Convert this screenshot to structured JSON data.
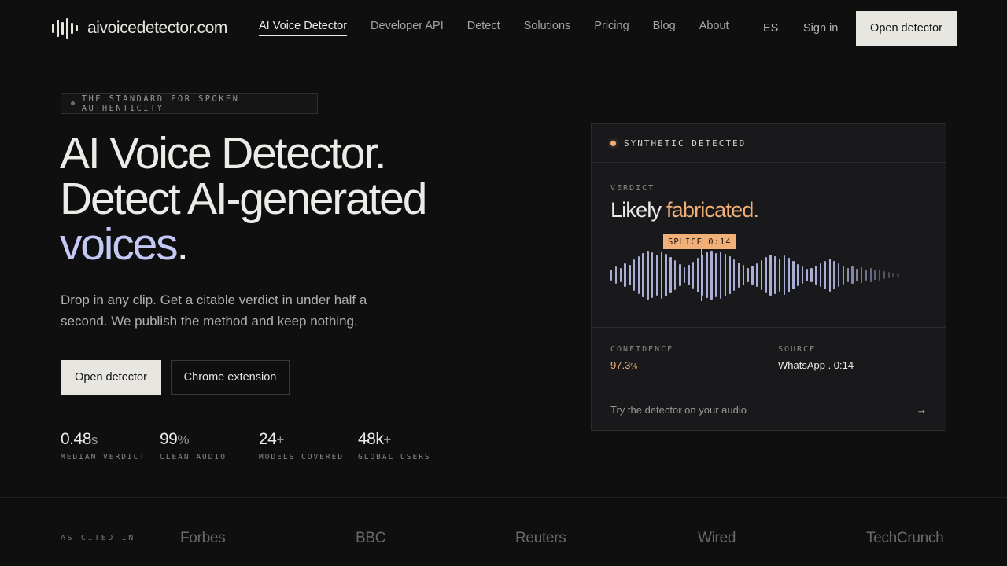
{
  "brand": {
    "name": "aivoicedetector.com",
    "logo_icon": "waveform-icon"
  },
  "nav": {
    "links": [
      "AI Voice Detector",
      "Developer API",
      "Detect",
      "Solutions",
      "Pricing",
      "Blog",
      "About"
    ],
    "active_index": 0,
    "lang": "ES",
    "signin": "Sign in",
    "cta": "Open detector"
  },
  "hero": {
    "eyebrow": "THE STANDARD FOR SPOKEN AUTHENTICITY",
    "headline_line1": "AI Voice Detector.",
    "headline_line2": "Detect AI-generated",
    "headline_line3_accent": "voices",
    "headline_line3_end": ".",
    "subtitle": "Drop in any clip. Get a citable verdict in under half a second. We publish the method and keep nothing.",
    "primary_cta": "Open detector",
    "secondary_cta": "Chrome extension",
    "stats": [
      {
        "value": "0.48",
        "unit": "s",
        "label": "MEDIAN VERDICT"
      },
      {
        "value": "99",
        "unit": "%",
        "label": "CLEAN AUDIO"
      },
      {
        "value": "24",
        "unit": "+",
        "label": "MODELS COVERED"
      },
      {
        "value": "48k",
        "unit": "+",
        "label": "GLOBAL USERS"
      }
    ]
  },
  "card": {
    "status": "SYNTHETIC DETECTED",
    "verdict_label": "VERDICT",
    "verdict_prefix": "Likely ",
    "verdict_highlight": "fabricated",
    "verdict_suffix": ".",
    "splice_tag": "SPLICE 0:14",
    "confidence_label": "CONFIDENCE",
    "confidence_value": "97.3",
    "confidence_unit": "%",
    "source_label": "SOURCE",
    "source_value": "WhatsApp . 0:14",
    "footer_text": "Try the detector on your audio",
    "footer_arrow": "→"
  },
  "cited": {
    "label": "AS CITED IN",
    "outlets": [
      "Forbes",
      "BBC",
      "Reuters",
      "Wired",
      "TechCrunch"
    ]
  },
  "colors": {
    "background": "#0f0f10",
    "accent_lavender": "#c4c8f4",
    "accent_orange": "#f2b079",
    "text_primary": "#ecebe7"
  }
}
